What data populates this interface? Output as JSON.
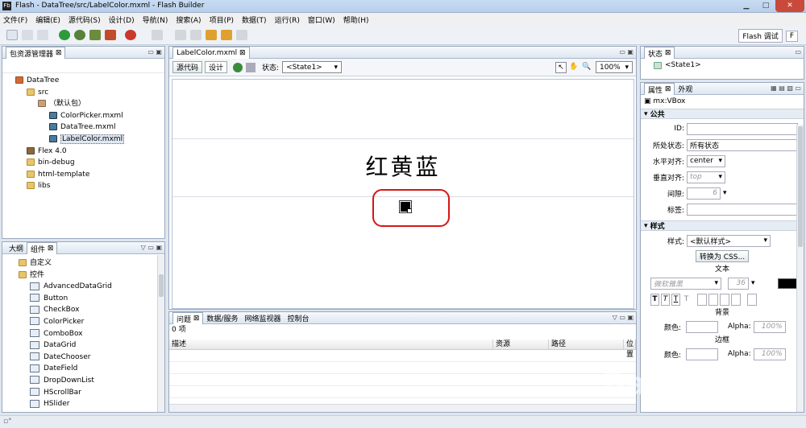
{
  "window": {
    "title": "Flash - DataTree/src/LabelColor.mxml - Flash Builder",
    "icon": "Fb"
  },
  "menu": [
    "文件(F)",
    "编辑(E)",
    "源代码(S)",
    "设计(D)",
    "导航(N)",
    "搜索(A)",
    "项目(P)",
    "数据(T)",
    "运行(R)",
    "窗口(W)",
    "帮助(H)"
  ],
  "perspective": {
    "debug": "Flash 调试",
    "flash": "F"
  },
  "explorer": {
    "tab": "包资源管理器",
    "items": [
      {
        "label": "DataTree",
        "indent": 0,
        "icon": "project-icon"
      },
      {
        "label": "src",
        "indent": 1,
        "icon": "folder-icon"
      },
      {
        "label": "（默认包）",
        "indent": 2,
        "icon": "package-icon"
      },
      {
        "label": "ColorPicker.mxml",
        "indent": 3,
        "icon": "mxml-icon"
      },
      {
        "label": "DataTree.mxml",
        "indent": 3,
        "icon": "mxml-icon"
      },
      {
        "label": "LabelColor.mxml",
        "indent": 3,
        "icon": "mxml-icon",
        "selected": true
      },
      {
        "label": "Flex 4.0",
        "indent": 1,
        "icon": "library-icon"
      },
      {
        "label": "bin-debug",
        "indent": 1,
        "icon": "folder-icon"
      },
      {
        "label": "html-template",
        "indent": 1,
        "icon": "folder-icon"
      },
      {
        "label": "libs",
        "indent": 1,
        "icon": "folder-icon"
      }
    ]
  },
  "components": {
    "tab_outline": "大纲",
    "tab_components": "组件",
    "items": [
      {
        "label": "自定义",
        "indent": 0,
        "folder": true
      },
      {
        "label": "控件",
        "indent": 0,
        "folder": true
      },
      {
        "label": "AdvancedDataGrid",
        "indent": 1
      },
      {
        "label": "Button",
        "indent": 1
      },
      {
        "label": "CheckBox",
        "indent": 1
      },
      {
        "label": "ColorPicker",
        "indent": 1
      },
      {
        "label": "ComboBox",
        "indent": 1
      },
      {
        "label": "DataGrid",
        "indent": 1
      },
      {
        "label": "DateChooser",
        "indent": 1
      },
      {
        "label": "DateField",
        "indent": 1
      },
      {
        "label": "DropDownList",
        "indent": 1
      },
      {
        "label": "HScrollBar",
        "indent": 1
      },
      {
        "label": "HSlider",
        "indent": 1
      }
    ]
  },
  "editor": {
    "tab": "LabelColor.mxml",
    "source_label": "源代码",
    "design_label": "设计",
    "state_label": "状态:",
    "state_value": "<State1>",
    "zoom": "100%",
    "canvas_text": "红黄蓝"
  },
  "problems": {
    "tabs": [
      "问题",
      "数据/服务",
      "网络监视器",
      "控制台"
    ],
    "count": "0 项",
    "columns": [
      "描述",
      "资源",
      "路径",
      "位置"
    ]
  },
  "states": {
    "tab": "状态",
    "item": "<State1>"
  },
  "properties": {
    "tab": "属性",
    "tab2": "外观",
    "component": "mx:VBox",
    "common": "公共",
    "fields": [
      {
        "label": "ID:",
        "value": ""
      },
      {
        "label": "所处状态:",
        "value": "所有状态"
      },
      {
        "label": "水平对齐:",
        "value": "center"
      },
      {
        "label": "垂直对齐:",
        "value": "top"
      },
      {
        "label": "间隙:",
        "value": "6"
      },
      {
        "label": "标签:",
        "value": ""
      }
    ],
    "style_section": "样式",
    "style_label": "样式:",
    "style_value": "<默认样式>",
    "css_button": "转换为 CSS...",
    "text_heading": "文本",
    "font_value": "微软雅黑",
    "font_size": "36",
    "bg_heading": "背景",
    "color_label": "颜色:",
    "alpha_label": "Alpha:",
    "alpha_value": "100%",
    "border_heading": "边框",
    "color_label2": "颜色:",
    "alpha_label2": "Alpha:",
    "alpha_value2": "100%"
  },
  "watermark": "jingyan.baidu.com"
}
